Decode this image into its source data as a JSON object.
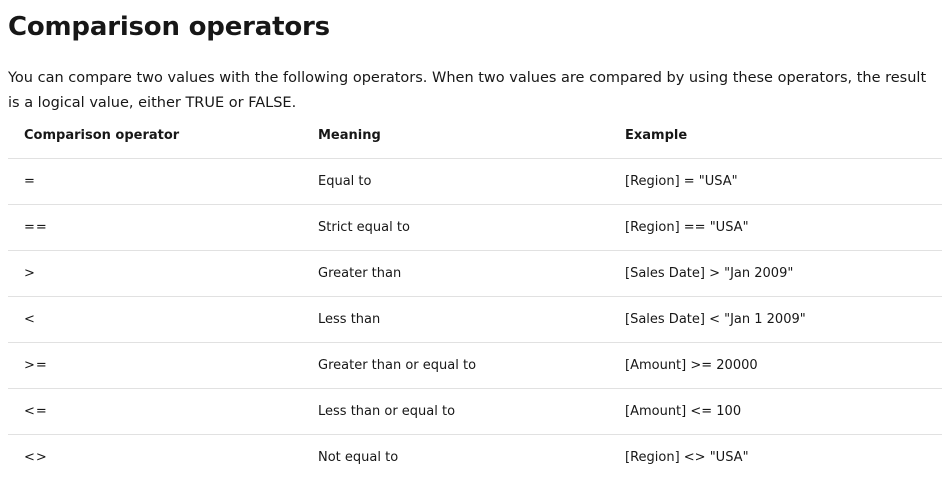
{
  "heading": "Comparison operators",
  "intro": "You can compare two values with the following operators. When two values are compared by using these operators, the result is a logical value, either TRUE or FALSE.",
  "table": {
    "headers": [
      "Comparison operator",
      "Meaning",
      "Example"
    ],
    "rows": [
      [
        "=",
        "Equal to",
        "[Region] = \"USA\""
      ],
      [
        "==",
        "Strict equal to",
        "[Region] == \"USA\""
      ],
      [
        ">",
        "Greater than",
        "[Sales Date] > \"Jan 2009\""
      ],
      [
        "<",
        "Less than",
        "[Sales Date] < \"Jan 1 2009\""
      ],
      [
        ">=",
        "Greater than or equal to",
        "[Amount] >= 20000"
      ],
      [
        "<=",
        "Less than or equal to",
        "[Amount] <= 100"
      ],
      [
        "<>",
        "Not equal to",
        "[Region] <> \"USA\""
      ]
    ]
  }
}
